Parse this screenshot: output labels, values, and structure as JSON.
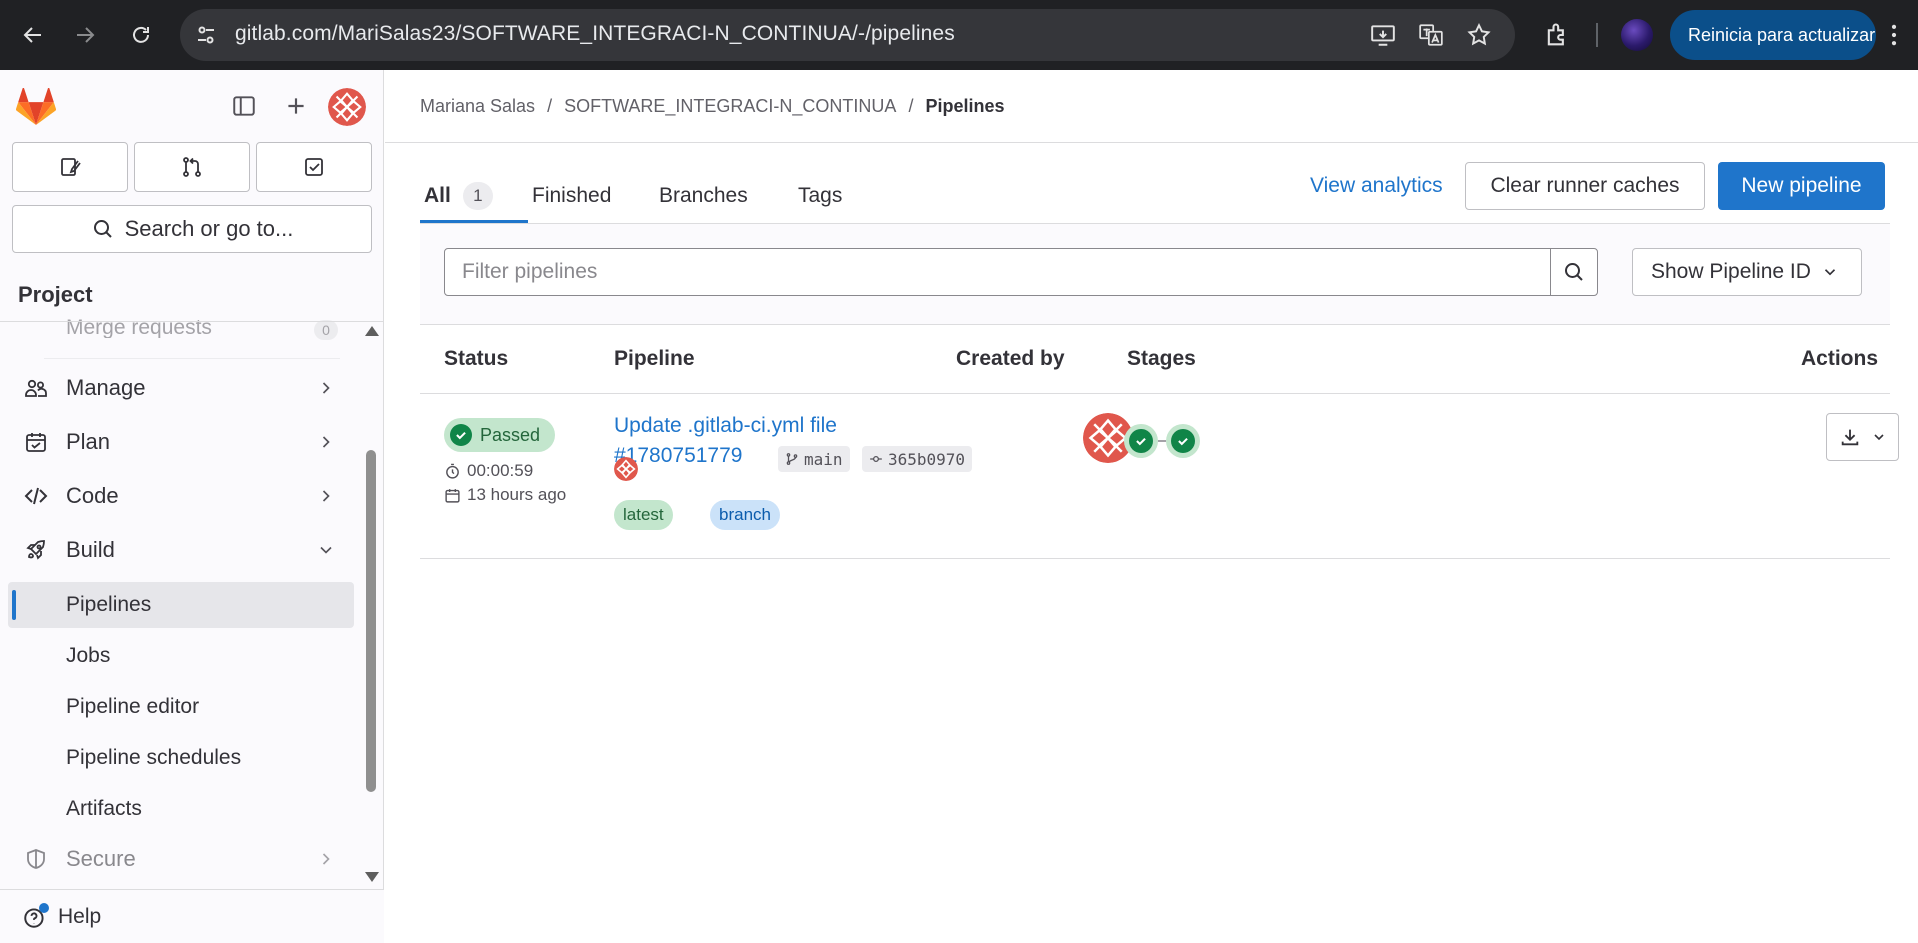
{
  "browser": {
    "url": "gitlab.com/MariSalas23/SOFTWARE_INTEGRACI-N_CONTINUA/-/pipelines",
    "update_button": "Reinicia para actualizar"
  },
  "sidebar": {
    "search_label": "Search or go to...",
    "section_title": "Project",
    "ghost_item": "Merge requests",
    "ghost_count": "0",
    "items": [
      {
        "label": "Manage",
        "icon": "users-icon"
      },
      {
        "label": "Plan",
        "icon": "calendar-icon"
      },
      {
        "label": "Code",
        "icon": "code-icon"
      },
      {
        "label": "Build",
        "icon": "rocket-icon"
      }
    ],
    "build_subitems": [
      "Pipelines",
      "Jobs",
      "Pipeline editor",
      "Pipeline schedules",
      "Artifacts"
    ],
    "secure_label": "Secure",
    "help_label": "Help"
  },
  "breadcrumb": {
    "owner": "Mariana Salas",
    "project": "SOFTWARE_INTEGRACI-N_CONTINUA",
    "current": "Pipelines",
    "separator": "/"
  },
  "tabs": [
    {
      "label": "All",
      "count": "1"
    },
    {
      "label": "Finished"
    },
    {
      "label": "Branches"
    },
    {
      "label": "Tags"
    }
  ],
  "header_actions": {
    "view_analytics": "View analytics",
    "clear_caches": "Clear runner caches",
    "new_pipeline": "New pipeline"
  },
  "filter": {
    "placeholder": "Filter pipelines",
    "show_id": "Show Pipeline ID"
  },
  "table": {
    "columns": [
      "Status",
      "Pipeline",
      "Created by",
      "Stages",
      "Actions"
    ],
    "rows": [
      {
        "status": "Passed",
        "duration": "00:00:59",
        "finished": "13 hours ago",
        "title": "Update .gitlab-ci.yml file",
        "id": "#1780751779",
        "branch": "main",
        "commit": "365b0970",
        "badges": [
          "latest",
          "branch"
        ],
        "stages": [
          "passed",
          "passed"
        ]
      }
    ]
  },
  "colors": {
    "accent": "#1f75cb",
    "success": "#108548",
    "success_bg": "#c3e6cd",
    "chrome_bg": "#202124",
    "tanuki_orange": "#e24329"
  }
}
